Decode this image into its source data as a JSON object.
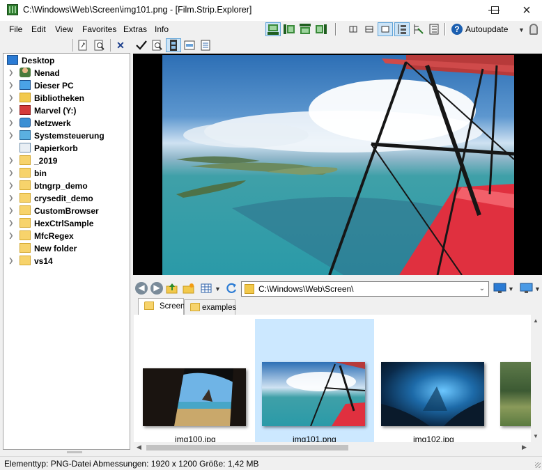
{
  "window": {
    "title": "C:\\Windows\\Web\\Screen\\img101.png - [Film.Strip.Explorer]",
    "controls": [
      "minimize",
      "maximize",
      "close"
    ]
  },
  "menu": {
    "items": [
      "File",
      "Edit",
      "View",
      "Favorites",
      "Extras",
      "Info"
    ],
    "autoupdate_label": "Autoupdate",
    "help_glyph": "?"
  },
  "tree": {
    "items": [
      {
        "label": "Desktop",
        "icon": "desktop-icon",
        "expandable": false
      },
      {
        "label": "Nenad",
        "icon": "user-icon",
        "expandable": true
      },
      {
        "label": "Dieser PC",
        "icon": "computer-icon",
        "expandable": true
      },
      {
        "label": "Bibliotheken",
        "icon": "library-icon",
        "expandable": true
      },
      {
        "label": "Marvel (Y:)",
        "icon": "network-drive-icon",
        "expandable": true
      },
      {
        "label": "Netzwerk",
        "icon": "network-icon",
        "expandable": true
      },
      {
        "label": "Systemsteuerung",
        "icon": "control-panel-icon",
        "expandable": true
      },
      {
        "label": "Papierkorb",
        "icon": "recycle-bin-icon",
        "expandable": false
      },
      {
        "label": "_2019",
        "icon": "folder-icon",
        "expandable": true
      },
      {
        "label": "bin",
        "icon": "folder-icon",
        "expandable": true
      },
      {
        "label": "btngrp_demo",
        "icon": "folder-icon",
        "expandable": true
      },
      {
        "label": "crysedit_demo",
        "icon": "folder-icon",
        "expandable": true
      },
      {
        "label": "CustomBrowser",
        "icon": "folder-icon",
        "expandable": true
      },
      {
        "label": "HexCtrlSample",
        "icon": "folder-icon",
        "expandable": true
      },
      {
        "label": "MfcRegex",
        "icon": "folder-icon",
        "expandable": true
      },
      {
        "label": "New folder",
        "icon": "folder-icon",
        "expandable": false
      },
      {
        "label": "vs14",
        "icon": "folder-icon",
        "expandable": true
      }
    ]
  },
  "address": {
    "path": "C:\\Windows\\Web\\Screen\\"
  },
  "tabs": [
    {
      "label": "Screen",
      "active": true
    },
    {
      "label": "examples",
      "active": false
    }
  ],
  "thumbnails": [
    {
      "caption": "img100.jpg",
      "selected": false
    },
    {
      "caption": "img101.png",
      "selected": true
    },
    {
      "caption": "img102.jpg",
      "selected": false
    }
  ],
  "status": {
    "text": "Elementtyp: PNG-Datei Abmessungen: 1920 x 1200 Größe: 1,42 MB"
  },
  "colors": {
    "selection": "#cce8ff",
    "toolbar_active": "#cce4f7",
    "wing_red": "#e0303f"
  }
}
